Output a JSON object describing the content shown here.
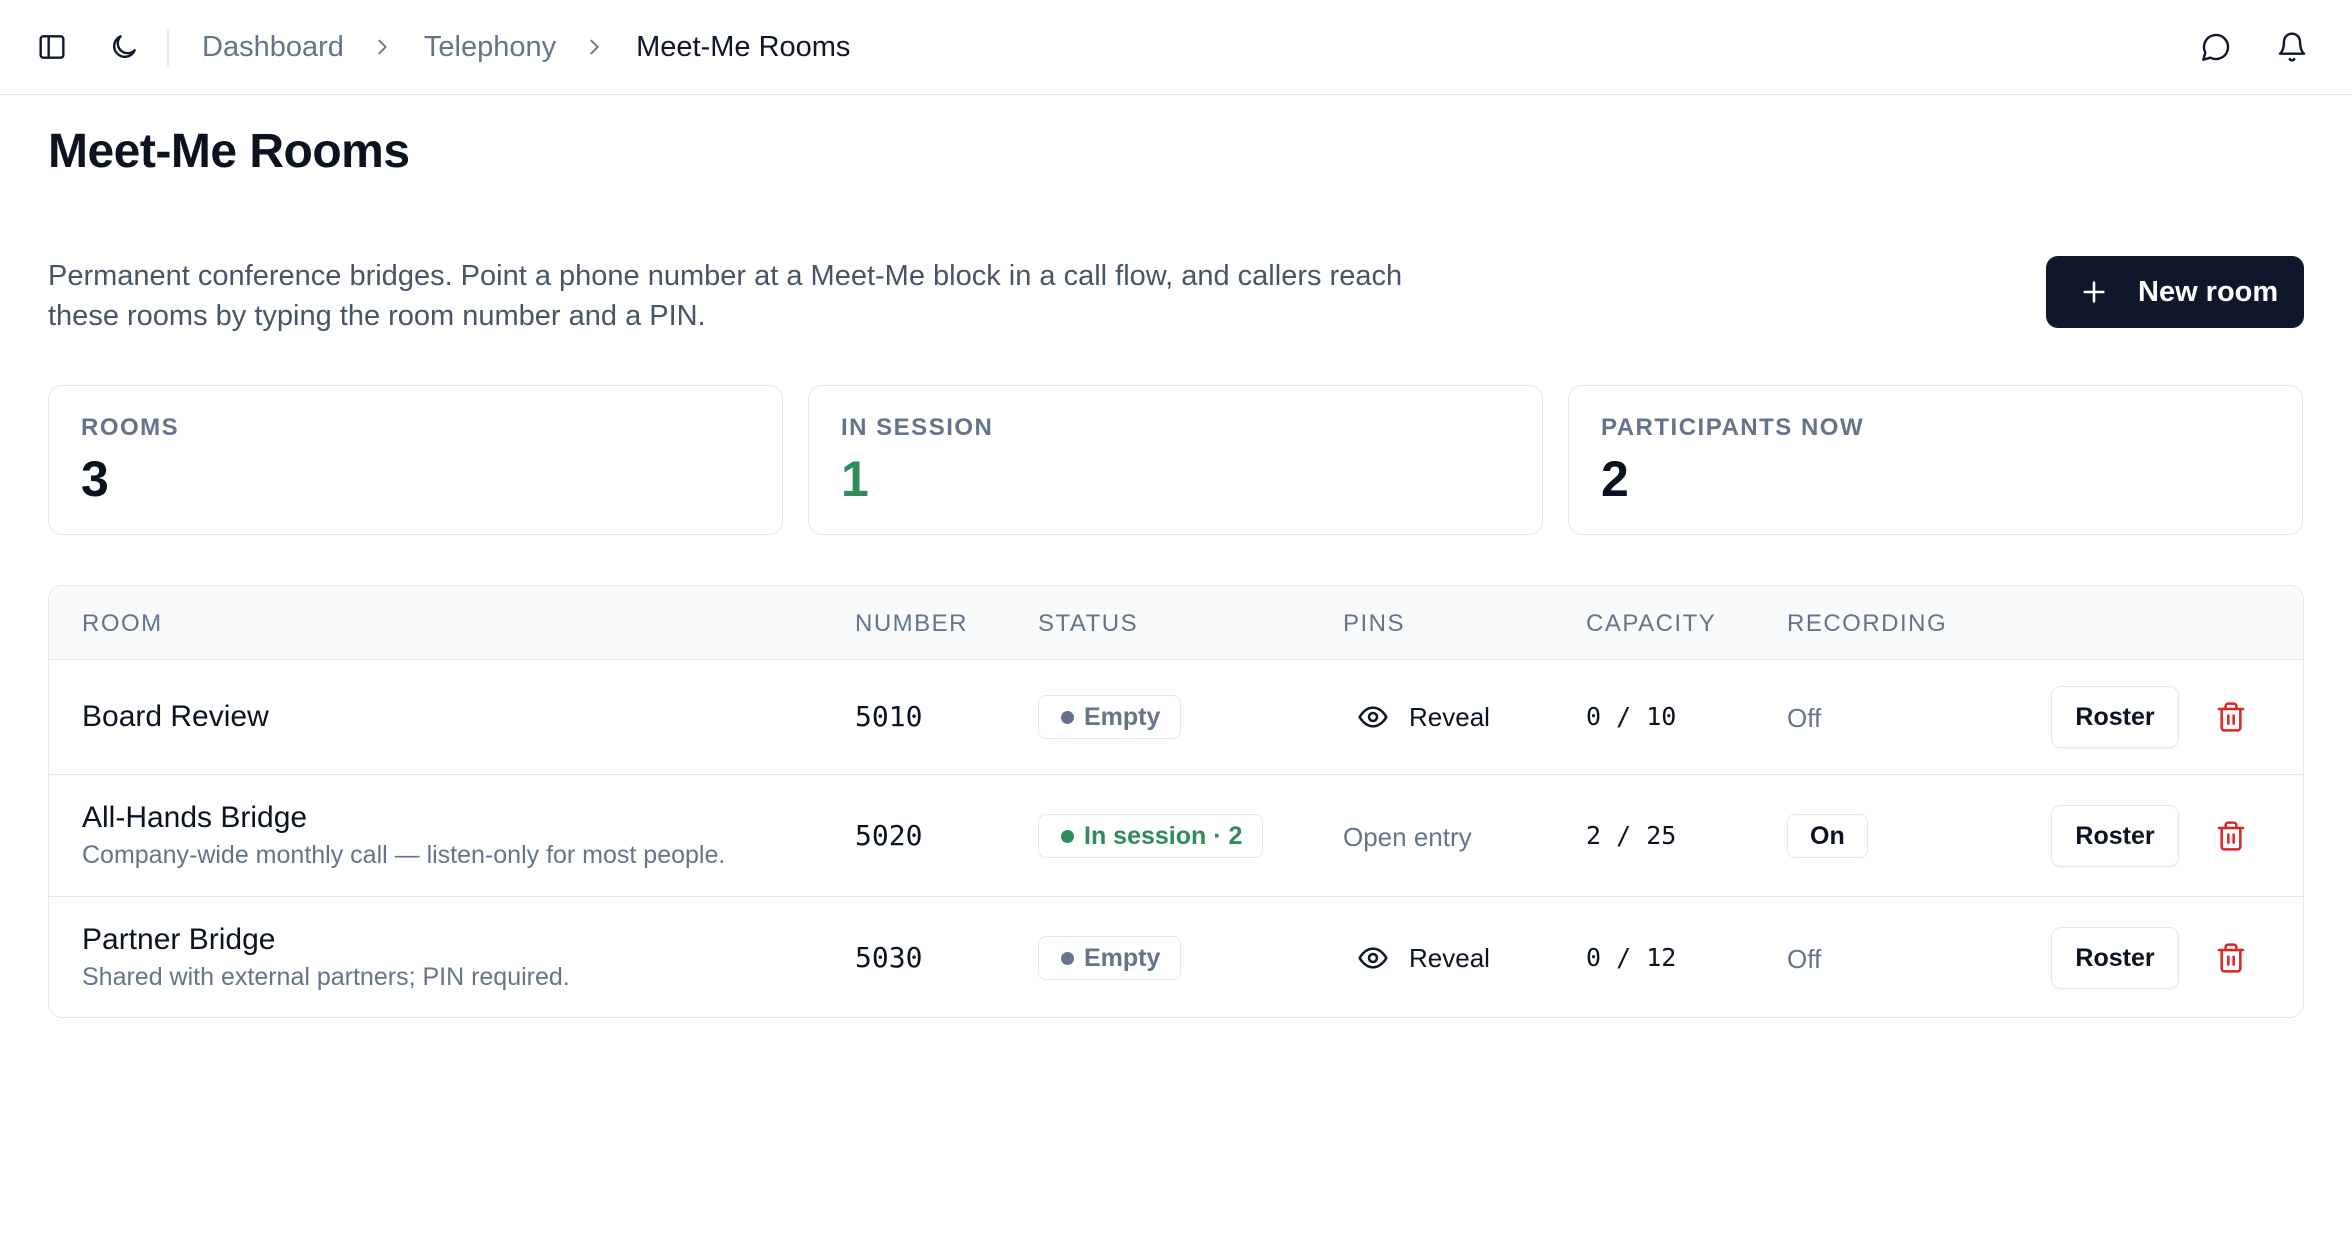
{
  "breadcrumb": {
    "items": [
      "Dashboard",
      "Telephony"
    ],
    "current": "Meet-Me Rooms"
  },
  "page": {
    "title": "Meet-Me Rooms",
    "description": "Permanent conference bridges. Point a phone number at a Meet-Me block in a call flow, and callers reach these rooms by typing the room number and a PIN.",
    "new_room_label": "New room"
  },
  "stats": [
    {
      "label": "ROOMS",
      "value": "3"
    },
    {
      "label": "IN SESSION",
      "value": "1"
    },
    {
      "label": "PARTICIPANTS NOW",
      "value": "2"
    }
  ],
  "table": {
    "headers": [
      "ROOM",
      "NUMBER",
      "STATUS",
      "PINS",
      "CAPACITY",
      "RECORDING"
    ],
    "rows": [
      {
        "name": "Board Review",
        "description": "",
        "number": "5010",
        "status": "Empty",
        "pins": "Reveal",
        "capacity": "0 / 10",
        "recording": "Off",
        "roster_label": "Roster"
      },
      {
        "name": "All-Hands Bridge",
        "description": "Company-wide monthly call — listen-only for most people.",
        "number": "5020",
        "status": "In session · 2",
        "pins": "Open entry",
        "capacity": "2 / 25",
        "recording": "On",
        "roster_label": "Roster"
      },
      {
        "name": "Partner Bridge",
        "description": "Shared with external partners; PIN required.",
        "number": "5030",
        "status": "Empty",
        "pins": "Reveal",
        "capacity": "0 / 12",
        "recording": "Off",
        "roster_label": "Roster"
      }
    ]
  },
  "colors": {
    "primary": "#0f172a",
    "success": "#2f8a5c",
    "danger": "#dc2626",
    "muted": "#64748b",
    "border": "#e5e7eb"
  },
  "icons": [
    "sidebar-toggle-icon",
    "moon-icon",
    "chevron-right-icon",
    "message-icon",
    "bell-icon",
    "plus-icon",
    "eye-icon",
    "trash-icon"
  ]
}
